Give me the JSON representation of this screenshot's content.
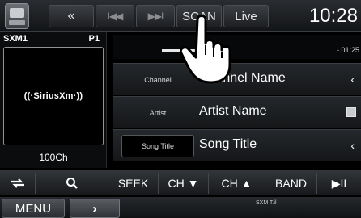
{
  "topbar": {
    "rewind_label": "«",
    "prev_label": "I◀◀",
    "next_label": "▶▶I",
    "scan_label": "SCAN",
    "live_label": "Live",
    "clock": "10:28"
  },
  "channel_info": {
    "band": "SXM1",
    "preset": "P1",
    "logo_text": "((·SiriusXm·))",
    "channel_number": "100Ch"
  },
  "playback": {
    "progress": 1.0,
    "remaining": "- 01:25"
  },
  "info_rows": [
    {
      "label": "Channel",
      "value": "Channel Name"
    },
    {
      "label": "Artist",
      "value": "Artist Name"
    },
    {
      "label": "Song Title",
      "value": "Song Title"
    }
  ],
  "controls": {
    "seek": "SEEK",
    "ch_down": "CH ▼",
    "ch_up": "CH ▲",
    "band": "BAND",
    "play_pause": "▶II"
  },
  "menu_bar": {
    "menu_label": "MENU",
    "arrow_label": "›",
    "status": "SXM T.il"
  }
}
